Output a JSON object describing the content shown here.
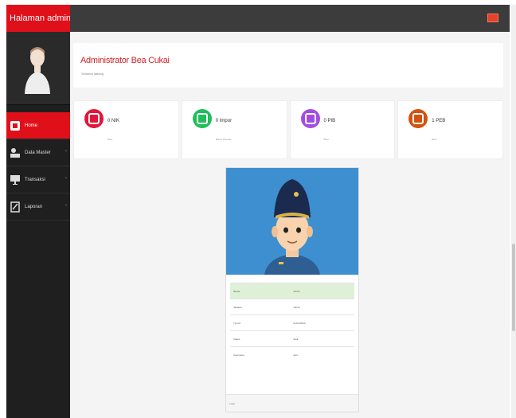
{
  "brand": {
    "title": "Halaman admin"
  },
  "sidebar": {
    "items": [
      {
        "label": "Home",
        "icon": "dashboard-icon",
        "active": true
      },
      {
        "label": "Data Master",
        "icon": "users-icon",
        "active": false
      },
      {
        "label": "Transaksi",
        "icon": "monitor-icon",
        "active": false
      },
      {
        "label": "Laporan",
        "icon": "report-icon",
        "active": false
      }
    ]
  },
  "header": {
    "title": "Administrator Bea Cukai",
    "subtitle": "Selamat datang"
  },
  "stats": [
    {
      "value": "0 NIK",
      "sub": "Baru",
      "icon": "envelope-icon",
      "color": "#e0163b"
    },
    {
      "value": "0 Impor",
      "sub": "Belum Dicetak",
      "icon": "list-icon",
      "color": "#1fbf5b"
    },
    {
      "value": "0 PIB",
      "sub": "Baru",
      "icon": "document-icon",
      "color": "#a34de0"
    },
    {
      "value": "1 PEB",
      "sub": "Baru",
      "icon": "file-icon",
      "color": "#d2520f"
    }
  ],
  "profile": {
    "rows": [
      {
        "label": "Nama",
        "value": "admin"
      },
      {
        "label": "Jabatan",
        "value": "Admin"
      },
      {
        "label": "Tgl Lhr",
        "value": "01/01/2000"
      },
      {
        "label": "Status",
        "value": "Aktif"
      },
      {
        "label": "Username",
        "value": "adm"
      }
    ],
    "footer": "Login"
  },
  "colors": {
    "accent": "#e0101a",
    "sidebar": "#1f1f1f",
    "topbar": "#3c3c3c",
    "photo_bg": "#3d8fd0"
  }
}
